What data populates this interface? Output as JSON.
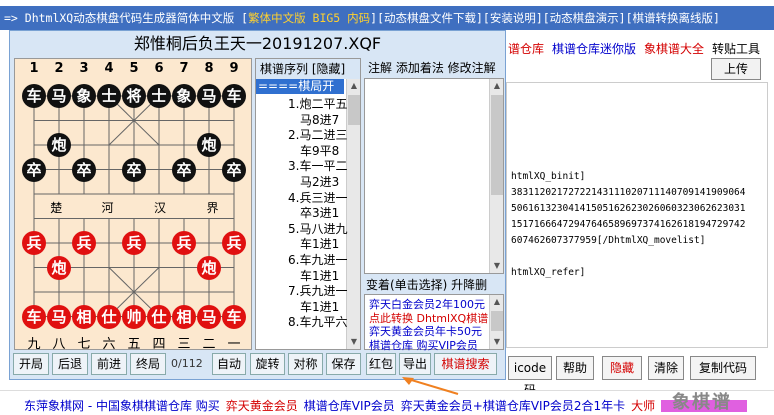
{
  "topbar": {
    "part1": "=> DhtmlXQ动态棋盘代码生成器简体中文版 [",
    "part2": "繁体中文版 BIG5 内码",
    "part3": "][动态棋盘文件下载][安装说明][动态棋盘演示][棋谱转换离线版]"
  },
  "right_page": {
    "links": [
      {
        "text": "谱仓库",
        "color": "red"
      },
      {
        "text": "棋谱仓库迷你版",
        "color": "blue"
      },
      {
        "text": "象棋谱大全",
        "color": "red"
      },
      {
        "text": "转贴工具",
        "color": "black"
      }
    ],
    "upload_label": "上传",
    "code_lines": [
      "htmlXQ_binit]",
      "38311202172722143111020711140709141909064",
      "50616132304141505162623026060323062623031",
      "15171666472947646589697374162618194729742",
      "607462607377959[/DhtmlXQ_movelist]",
      "",
      "htmlXQ_refer]"
    ],
    "buttons": [
      "icode码",
      "帮助",
      "隐藏",
      "清除",
      "复制代码"
    ]
  },
  "bottom_bar": {
    "items": [
      {
        "text": "东萍象棋网 - 中国象棋棋谱仓库 购买",
        "color": "blue"
      },
      {
        "text": "弈天黄金会员",
        "color": "red"
      },
      {
        "text": "棋谱仓库VIP会员",
        "color": "blue"
      },
      {
        "text": "弈天黄金会员+棋谱仓库VIP会员2合1年卡",
        "color": "blue"
      },
      {
        "text": "大师",
        "color": "red"
      }
    ]
  },
  "dialog": {
    "title": "郑惟桐后负王天一20191207.XQF",
    "top_files": [
      "1",
      "2",
      "3",
      "4",
      "5",
      "6",
      "7",
      "8",
      "9"
    ],
    "bottom_files": [
      "九",
      "八",
      "七",
      "六",
      "五",
      "四",
      "三",
      "二",
      "一"
    ],
    "river": [
      "楚",
      "河",
      "汉",
      "界"
    ],
    "pieces": [
      {
        "t": "车",
        "s": "b",
        "f": 0,
        "r": 0
      },
      {
        "t": "马",
        "s": "b",
        "f": 1,
        "r": 0
      },
      {
        "t": "象",
        "s": "b",
        "f": 2,
        "r": 0
      },
      {
        "t": "士",
        "s": "b",
        "f": 3,
        "r": 0
      },
      {
        "t": "将",
        "s": "b",
        "f": 4,
        "r": 0
      },
      {
        "t": "士",
        "s": "b",
        "f": 5,
        "r": 0
      },
      {
        "t": "象",
        "s": "b",
        "f": 6,
        "r": 0
      },
      {
        "t": "马",
        "s": "b",
        "f": 7,
        "r": 0
      },
      {
        "t": "车",
        "s": "b",
        "f": 8,
        "r": 0
      },
      {
        "t": "炮",
        "s": "b",
        "f": 1,
        "r": 2
      },
      {
        "t": "炮",
        "s": "b",
        "f": 7,
        "r": 2
      },
      {
        "t": "卒",
        "s": "b",
        "f": 0,
        "r": 3
      },
      {
        "t": "卒",
        "s": "b",
        "f": 2,
        "r": 3
      },
      {
        "t": "卒",
        "s": "b",
        "f": 4,
        "r": 3
      },
      {
        "t": "卒",
        "s": "b",
        "f": 6,
        "r": 3
      },
      {
        "t": "卒",
        "s": "b",
        "f": 8,
        "r": 3
      },
      {
        "t": "兵",
        "s": "r",
        "f": 0,
        "r": 6
      },
      {
        "t": "兵",
        "s": "r",
        "f": 2,
        "r": 6
      },
      {
        "t": "兵",
        "s": "r",
        "f": 4,
        "r": 6
      },
      {
        "t": "兵",
        "s": "r",
        "f": 6,
        "r": 6
      },
      {
        "t": "兵",
        "s": "r",
        "f": 8,
        "r": 6
      },
      {
        "t": "炮",
        "s": "r",
        "f": 1,
        "r": 7
      },
      {
        "t": "炮",
        "s": "r",
        "f": 7,
        "r": 7
      },
      {
        "t": "车",
        "s": "r",
        "f": 0,
        "r": 9
      },
      {
        "t": "马",
        "s": "r",
        "f": 1,
        "r": 9
      },
      {
        "t": "相",
        "s": "r",
        "f": 2,
        "r": 9
      },
      {
        "t": "仕",
        "s": "r",
        "f": 3,
        "r": 9
      },
      {
        "t": "帅",
        "s": "r",
        "f": 4,
        "r": 9
      },
      {
        "t": "仕",
        "s": "r",
        "f": 5,
        "r": 9
      },
      {
        "t": "相",
        "s": "r",
        "f": 6,
        "r": 9
      },
      {
        "t": "马",
        "s": "r",
        "f": 7,
        "r": 9
      },
      {
        "t": "车",
        "s": "r",
        "f": 8,
        "r": 9
      }
    ],
    "moves_header": "棋谱序列  [隐藏]",
    "moves_start": "====棋局开始",
    "moves": [
      "1.炮二平五",
      "马8进7",
      "2.马二进三",
      "车9平8",
      "3.车一平二",
      "马2进3",
      "4.兵三进一",
      "卒3进1",
      "5.马八进九",
      "车1进1",
      "6.车九进一",
      "车1进1",
      "7.兵九进一",
      "车1进1",
      "8.车九平六"
    ],
    "annot_header": "注解 添加着法 修改注解",
    "var_header": "变着(单击选择)  升降删",
    "var_lines": [
      {
        "text": "弈天白金会员2年100元",
        "color": "blue"
      },
      {
        "text": "点此转换 DhtmlXQ棋谱",
        "color": "red"
      },
      {
        "text": "弈天黄金会员年卡50元",
        "color": "blue"
      },
      {
        "text": "棋谱仓库  购买VIP会员",
        "color": "blue"
      }
    ],
    "buttons": [
      "开局",
      "后退",
      "前进",
      "终局",
      "自动",
      "旋转",
      "对称",
      "保存",
      "红包",
      "导出",
      "棋谱搜索"
    ],
    "counter": "0/112"
  },
  "watermark": "象棋谱"
}
